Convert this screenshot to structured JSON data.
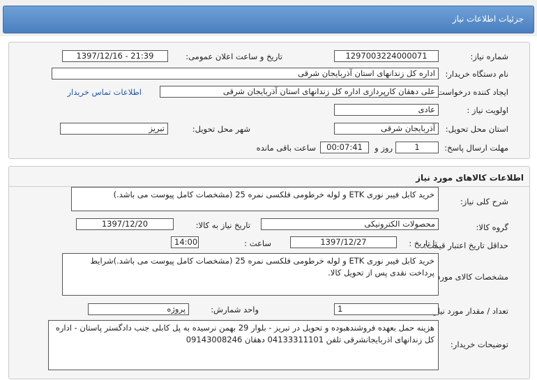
{
  "title": "جزئیات اطلاعات نیاز",
  "info": {
    "need_number_label": "شماره نیاز:",
    "need_number": "1297003224000071",
    "announce_label": "تاریخ و ساعت اعلان عمومی:",
    "announce_value": "1397/12/16 - 21:39",
    "buyer_org_label": "نام دستگاه خریدار:",
    "buyer_org": "اداره کل زندانهای استان آذربایجان شرقی",
    "requester_label": "ایجاد کننده درخواست:",
    "requester": "علی دهقان کارپردازی اداره کل زندانهای استان آذربایجان شرقی",
    "contact_link": "اطلاعات تماس خریدار",
    "priority_label": "اولویت نیاز :",
    "priority": "عادی",
    "province_label": "استان محل تحویل:",
    "province": "آذربایجان شرقی",
    "city_label": "شهر محل تحویل:",
    "city": "تبریز",
    "deadline_label": "مهلت ارسال پاسخ:",
    "days": "1",
    "days_unit": "روز و",
    "time_left": "00:07:41",
    "time_left_suffix": "ساعت باقی مانده"
  },
  "goods": {
    "section_title": "اطلاعات کالاهای مورد نیاز",
    "summary_label": "شرح کلی نیاز:",
    "summary": "خرید کابل فیبر نوری ETK و لوله خرطومی فلکسی نمره 25 (مشخصات کامل پیوست می باشد.)",
    "group_label": "گروه کالا:",
    "group": "محصولات الکترونیکی",
    "need_date_label": "تاریخ نیاز به کالا:",
    "need_date": "1397/12/20",
    "min_price_label": "حداقل تاریخ اعتبار قیمت:",
    "to_date_label": "تا تاریخ :",
    "to_date": "1397/12/27",
    "hour_label": "ساعت :",
    "hour": "14:00",
    "spec_label": "مشخصات کالای مورد نیاز:",
    "spec": "خرید کابل فیبر نوری ETK و لوله خرطومی فلکسی نمره 25 (مشخصات کامل پیوست می باشد.)شرایط پرداخت نقدی پس از تحویل کالا.",
    "qty_label": "تعداد / مقدار مورد نیاز:",
    "qty": "1",
    "unit_label": "واحد شمارش:",
    "unit": "پروژه",
    "buyer_notes_label": "توضیحات خریدار:",
    "buyer_notes": "هزینه حمل بعهده فروشندهبوده و تحویل در تبریز - بلوار 29 بهمن نرسیده به پل کابلی جنب دادگستر پاستان - اداره کل زندانهای اذربایجانشرقی  تلفن 04133311101 دهقان 09143008246"
  }
}
